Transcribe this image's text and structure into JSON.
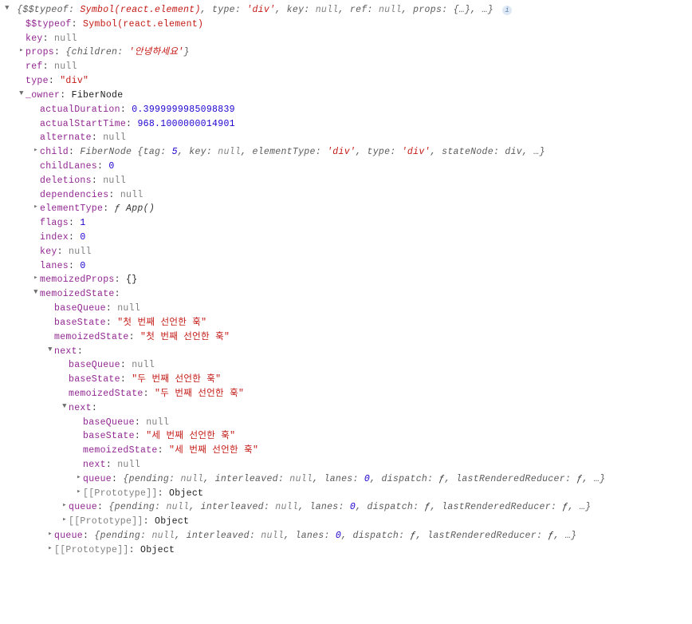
{
  "root": {
    "summary_prefix": "{$$typeof: ",
    "summary_symbol": "Symbol(react.element)",
    "summary_mid": ", type: ",
    "summary_type": "'div'",
    "summary_key": ", key: ",
    "summary_keynull": "null",
    "summary_ref": ", ref: ",
    "summary_refnull": "null",
    "summary_props": ", props: ",
    "summary_propsobj": "{…}",
    "summary_tail": ", …}"
  },
  "l1": {
    "typeof_k": "$$typeof",
    "typeof_v": "Symbol(react.element)",
    "key_k": "key",
    "key_v": "null",
    "props_k": "props",
    "props_sum_pre": "{children: ",
    "props_sum_v": "'안녕하세요'",
    "props_sum_post": "}",
    "ref_k": "ref",
    "ref_v": "null",
    "type_k": "type",
    "type_v": "\"div\"",
    "owner_k": "_owner",
    "owner_v": "FiberNode"
  },
  "owner": {
    "actualDuration_k": "actualDuration",
    "actualDuration_v": "0.3999999985098839",
    "actualStartTime_k": "actualStartTime",
    "actualStartTime_v": "968.1000000014901",
    "alternate_k": "alternate",
    "alternate_v": "null",
    "child_k": "child",
    "child_sum_pre": "FiberNode {tag: ",
    "child_sum_tag": "5",
    "child_sum_m1": ", key: ",
    "child_sum_keynull": "null",
    "child_sum_m2": ", elementType: ",
    "child_sum_et": "'div'",
    "child_sum_m3": ", type: ",
    "child_sum_ty": "'div'",
    "child_sum_m4": ", stateNode: ",
    "child_sum_sn": "div",
    "child_sum_tail": ", …}",
    "childLanes_k": "childLanes",
    "childLanes_v": "0",
    "deletions_k": "deletions",
    "deletions_v": "null",
    "dependencies_k": "dependencies",
    "dependencies_v": "null",
    "elementType_k": "elementType",
    "elementType_v": "ƒ App()",
    "flags_k": "flags",
    "flags_v": "1",
    "index_k": "index",
    "index_v": "0",
    "key_k": "key",
    "key_v": "null",
    "lanes_k": "lanes",
    "lanes_v": "0",
    "memoProps_k": "memoizedProps",
    "memoProps_v": "{}",
    "memoState_k": "memoizedState"
  },
  "ms1": {
    "baseQueue_k": "baseQueue",
    "baseQueue_v": "null",
    "baseState_k": "baseState",
    "baseState_v": "\"첫 번째 선언한 훅\"",
    "memoState_k": "memoizedState",
    "memoState_v": "\"첫 번째 선언한 훅\"",
    "next_k": "next"
  },
  "ms2": {
    "baseQueue_k": "baseQueue",
    "baseQueue_v": "null",
    "baseState_k": "baseState",
    "baseState_v": "\"두 번째 선언한 훅\"",
    "memoState_k": "memoizedState",
    "memoState_v": "\"두 번째 선언한 훅\"",
    "next_k": "next"
  },
  "ms3": {
    "baseQueue_k": "baseQueue",
    "baseQueue_v": "null",
    "baseState_k": "baseState",
    "baseState_v": "\"세 번째 선언한 훅\"",
    "memoState_k": "memoizedState",
    "memoState_v": "\"세 번째 선언한 훅\"",
    "next_k": "next",
    "next_v": "null"
  },
  "queue": {
    "k": "queue",
    "sum_pre": "{pending: ",
    "sum_pending": "null",
    "sum_m1": ", interleaved: ",
    "sum_interleaved": "null",
    "sum_m2": ", lanes: ",
    "sum_lanes": "0",
    "sum_m3": ", dispatch: ",
    "sum_dispatch": "ƒ",
    "sum_m4": ", lastRenderedReducer: ",
    "sum_lrr": "ƒ",
    "sum_tail": ", …}"
  },
  "proto": {
    "k": "[[Prototype]]",
    "v": "Object"
  }
}
